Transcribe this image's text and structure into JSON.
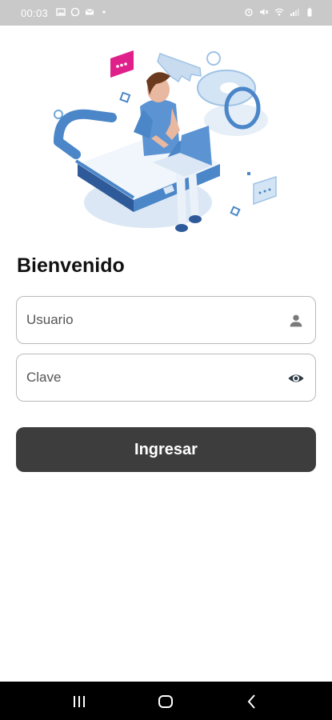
{
  "status_bar": {
    "time": "00:03",
    "left_icons": [
      "gallery-icon",
      "whatsapp-icon",
      "mail-icon",
      "dot-icon"
    ],
    "right_icons": [
      "alarm-icon",
      "mute-icon",
      "wifi-icon",
      "signal-icon",
      "battery-icon"
    ]
  },
  "hero": {
    "illustration": "person-with-laptop-on-padlock-illustration"
  },
  "login": {
    "title": "Bienvenido",
    "username": {
      "placeholder": "Usuario",
      "value": "",
      "icon": "person-icon"
    },
    "password": {
      "placeholder": "Clave",
      "value": "",
      "icon": "eye-icon"
    },
    "submit_label": "Ingresar"
  },
  "nav_bar": {
    "buttons": [
      "recent-apps-icon",
      "home-icon",
      "back-icon"
    ]
  },
  "colors": {
    "button": "#3d3d3d",
    "status_bar": "#c9c9c9",
    "accent_blue": "#4a86c8",
    "accent_pink": "#e0208a"
  }
}
